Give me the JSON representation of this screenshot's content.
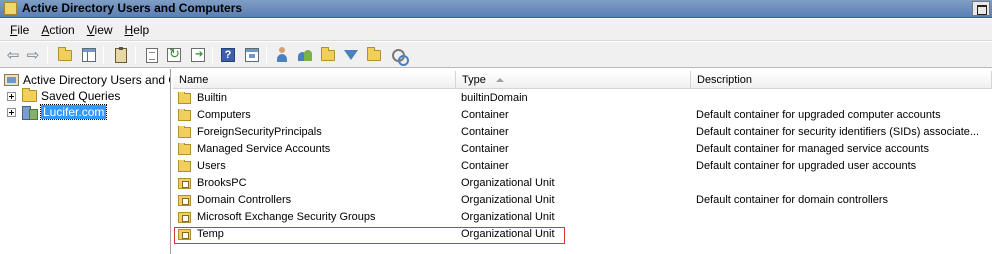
{
  "window": {
    "title": "Active Directory Users and Computers"
  },
  "menu": [
    "File",
    "Action",
    "View",
    "Help"
  ],
  "toolbar": {
    "icons": [
      "back-arrow-icon",
      "forward-arrow-icon",
      "up-folder-icon",
      "show-hide-tree-icon",
      "properties-icon",
      "export-list-icon",
      "refresh-icon",
      "export-icon",
      "help-icon",
      "view-icon",
      "new-user-icon",
      "new-group-icon",
      "new-ou-icon",
      "filter-icon",
      "find-icon",
      "delegate-icon"
    ]
  },
  "tree": {
    "root": "Active Directory Users and Co",
    "items": [
      {
        "label": "Saved Queries"
      },
      {
        "label": "Lucifer.com",
        "selected": true
      }
    ]
  },
  "list": {
    "columns": [
      "Name",
      "Type",
      "Description"
    ],
    "sorted_by": "Type",
    "rows": [
      {
        "name": "Builtin",
        "type": "builtinDomain",
        "description": "",
        "icon": "container"
      },
      {
        "name": "Computers",
        "type": "Container",
        "description": "Default container for upgraded computer accounts",
        "icon": "container"
      },
      {
        "name": "ForeignSecurityPrincipals",
        "type": "Container",
        "description": "Default container for security identifiers (SIDs) associate...",
        "icon": "container"
      },
      {
        "name": "Managed Service Accounts",
        "type": "Container",
        "description": "Default container for managed service accounts",
        "icon": "container"
      },
      {
        "name": "Users",
        "type": "Container",
        "description": "Default container for upgraded user accounts",
        "icon": "container"
      },
      {
        "name": "BrooksPC",
        "type": "Organizational Unit",
        "description": "",
        "icon": "ou"
      },
      {
        "name": "Domain Controllers",
        "type": "Organizational Unit",
        "description": "Default container for domain controllers",
        "icon": "ou"
      },
      {
        "name": "Microsoft Exchange Security Groups",
        "type": "Organizational Unit",
        "description": "",
        "icon": "ou"
      },
      {
        "name": "Temp",
        "type": "Organizational Unit",
        "description": "",
        "icon": "ou",
        "highlighted": true
      }
    ]
  },
  "colors": {
    "selection": "#3399ff",
    "highlight_border": "#d23a3a"
  }
}
